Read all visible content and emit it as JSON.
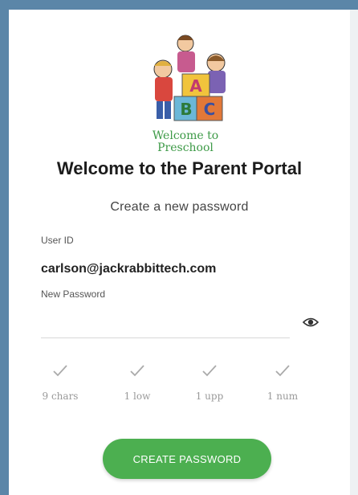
{
  "logo": {
    "caption_line1": "Welcome to",
    "caption_line2": "Preschool",
    "blocks": [
      "A",
      "B",
      "C"
    ]
  },
  "header": {
    "title": "Welcome to the Parent Portal",
    "subtitle": "Create a new password"
  },
  "form": {
    "userid_label": "User ID",
    "userid_value": "carlson@jackrabbittech.com",
    "password_label": "New Password",
    "password_value": ""
  },
  "rules": [
    {
      "label": "9 chars"
    },
    {
      "label": "1 low"
    },
    {
      "label": "1 upp"
    },
    {
      "label": "1 num"
    }
  ],
  "button": {
    "label": "CREATE PASSWORD"
  },
  "colors": {
    "background": "#5b86a8",
    "accent": "#4caf50",
    "check": "#aaaaaa"
  }
}
